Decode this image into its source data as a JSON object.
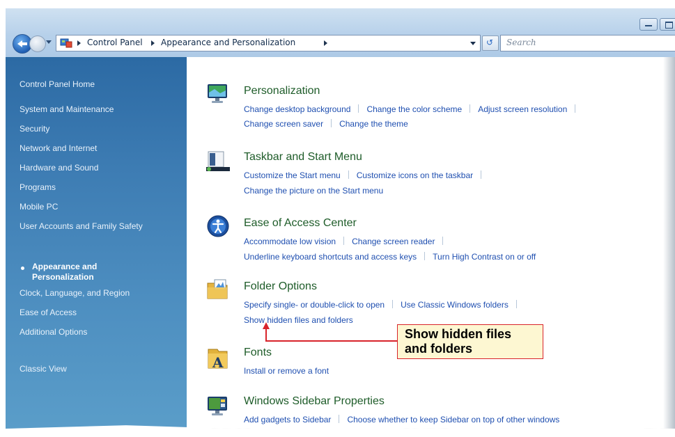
{
  "window": {
    "controls": [
      "minimize-icon",
      "maximize-icon"
    ]
  },
  "navbar": {
    "breadcrumbs": [
      "Control Panel",
      "Appearance and Personalization"
    ],
    "search_placeholder": "Search",
    "icons": [
      "back-arrow-icon",
      "forward-arrow-icon",
      "control-panel-icon",
      "refresh-icon"
    ]
  },
  "sidebar": {
    "items": [
      {
        "label": "Control Panel Home",
        "current": false
      },
      {
        "label": "System and Maintenance",
        "current": false
      },
      {
        "label": "Security",
        "current": false
      },
      {
        "label": "Network and Internet",
        "current": false
      },
      {
        "label": "Hardware and Sound",
        "current": false
      },
      {
        "label": "Programs",
        "current": false
      },
      {
        "label": "Mobile PC",
        "current": false
      },
      {
        "label": "User Accounts and Family Safety",
        "current": false
      },
      {
        "label": "Appearance and Personalization",
        "current": true
      },
      {
        "label": "Clock, Language, and Region",
        "current": false
      },
      {
        "label": "Ease of Access",
        "current": false
      },
      {
        "label": "Additional Options",
        "current": false
      },
      {
        "label": "Classic View",
        "current": false
      }
    ]
  },
  "categories": [
    {
      "title": "Personalization",
      "icon": "personalization-icon",
      "tasks": [
        [
          "Change desktop background",
          "Change the color scheme",
          "Adjust screen resolution"
        ],
        [
          "Change screen saver",
          "Change the theme"
        ]
      ]
    },
    {
      "title": "Taskbar and Start Menu",
      "icon": "taskbar-icon",
      "tasks": [
        [
          "Customize the Start menu",
          "Customize icons on the taskbar"
        ],
        [
          "Change the picture on the Start menu"
        ]
      ]
    },
    {
      "title": "Ease of Access Center",
      "icon": "ease-of-access-icon",
      "tasks": [
        [
          "Accommodate low vision",
          "Change screen reader"
        ],
        [
          "Underline keyboard shortcuts and access keys",
          "Turn High Contrast on or off"
        ]
      ]
    },
    {
      "title": "Folder Options",
      "icon": "folder-options-icon",
      "tasks": [
        [
          "Specify single- or double-click to open",
          "Use Classic Windows folders"
        ],
        [
          "Show hidden files and folders"
        ]
      ]
    },
    {
      "title": "Fonts",
      "icon": "fonts-icon",
      "tasks": [
        [
          "Install or remove a font"
        ]
      ]
    },
    {
      "title": "Windows Sidebar Properties",
      "icon": "sidebar-properties-icon",
      "tasks": [
        [
          "Add gadgets to Sidebar",
          "Choose whether to keep Sidebar on top of other windows"
        ]
      ]
    }
  ],
  "callout": {
    "lines": [
      "Show hidden files",
      "and folders"
    ],
    "colors": {
      "border": "#d8232a",
      "fill": "#fdf7d2",
      "leader": "#d8232a"
    }
  },
  "colors": {
    "sidebar_top": "#2c6aa4",
    "sidebar_bottom": "#5a9dc9",
    "category_title": "#1e5c29",
    "task_link": "#1f4fb0"
  }
}
